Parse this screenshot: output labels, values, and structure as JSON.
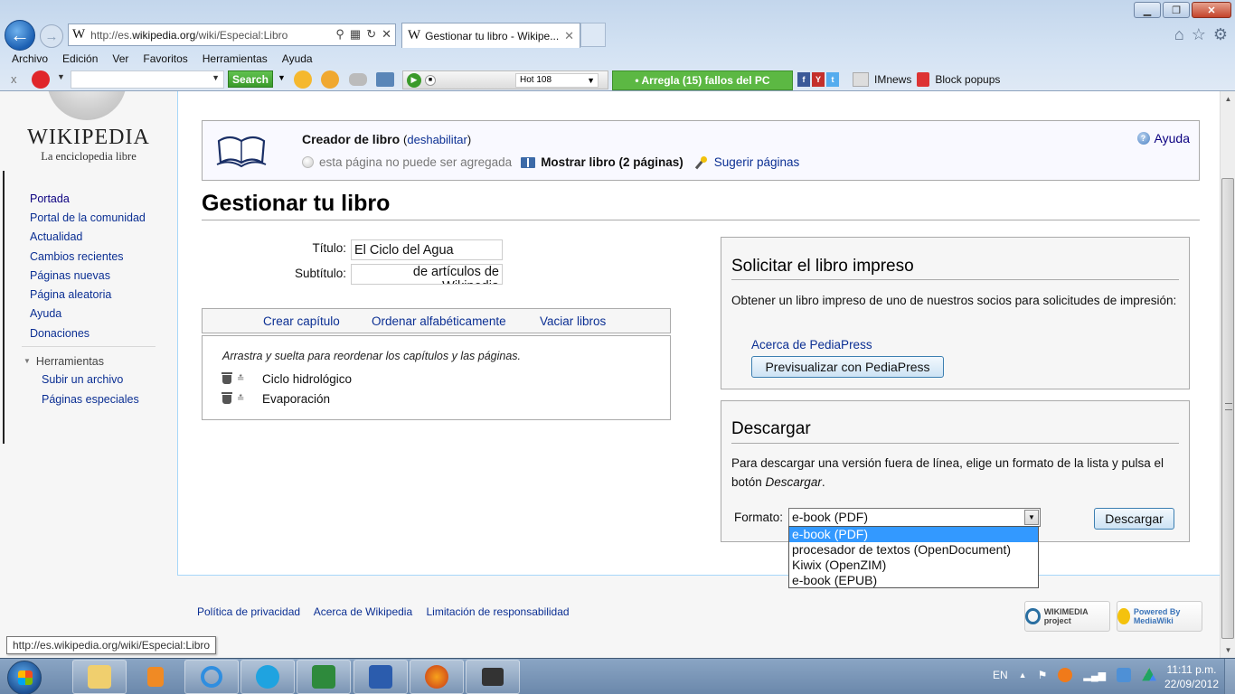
{
  "window": {
    "minimize_icon": "minimize-icon",
    "restore_icon": "restore-icon",
    "close_icon": "close-icon"
  },
  "browser": {
    "address": {
      "prefix": "http://es.",
      "domain": "wikipedia.org",
      "path": "/wiki/Especial:Libro"
    },
    "tab_title": "Gestionar tu libro - Wikipe...",
    "menu": [
      "Archivo",
      "Edición",
      "Ver",
      "Favoritos",
      "Herramientas",
      "Ayuda"
    ],
    "toolbar": {
      "search_button": "Search",
      "search_placeholder": "",
      "radio_station": "Hot 108",
      "fix_button": "• Arregla (15) fallos del PC",
      "imnews": "IMnews",
      "block_popups": "Block popups"
    }
  },
  "wiki": {
    "logo_wordmark": "WIKIPEDIA",
    "logo_tagline": "La enciclopedia libre",
    "sidebar": {
      "nav": [
        {
          "label": "Portada"
        },
        {
          "label": "Portal de la comunidad"
        },
        {
          "label": "Actualidad"
        },
        {
          "label": "Cambios recientes"
        },
        {
          "label": "Páginas nuevas"
        },
        {
          "label": "Página aleatoria"
        },
        {
          "label": "Ayuda"
        },
        {
          "label": "Donaciones"
        }
      ],
      "tools_header": "Herramientas",
      "tools": [
        {
          "label": "Subir un archivo"
        },
        {
          "label": "Páginas especiales"
        }
      ]
    },
    "book_creator": {
      "title": "Creador de libro",
      "disable_link": "deshabilitar",
      "cannot_add": "esta página no puede ser agregada",
      "show_book": "Mostrar libro (2 páginas)",
      "suggest": "Sugerir páginas",
      "help": "Ayuda"
    },
    "page_title": "Gestionar tu libro",
    "form": {
      "title_label": "Título:",
      "title_value": "El Ciclo del Agua",
      "subtitle_label": "Subtítulo:",
      "subtitle_value": "de artículos de Wikipedia"
    },
    "chapter_toolbar": {
      "create_chapter": "Crear capítulo",
      "sort_alpha": "Ordenar alfabéticamente",
      "clear_books": "Vaciar libros"
    },
    "chapter_hint": "Arrastra y suelta para reordenar los capítulos y las páginas.",
    "chapters": [
      {
        "title": "Ciclo hidrológico"
      },
      {
        "title": "Evaporación"
      }
    ],
    "print_panel": {
      "heading": "Solicitar el libro impreso",
      "text": "Obtener un libro impreso de uno de nuestros socios para solicitudes de impresión:",
      "about_link": "Acerca de PediaPress",
      "preview_button": "Previsualizar con PediaPress"
    },
    "download_panel": {
      "heading": "Descargar",
      "text_before": "Para descargar una versión fuera de línea, elige un formato de la lista y pulsa el botón ",
      "text_em": "Descargar",
      "text_after": ".",
      "format_label": "Formato:",
      "selected_format": "e-book (PDF)",
      "format_options": [
        {
          "label": "e-book (PDF)",
          "selected": true
        },
        {
          "label": "procesador de textos (OpenDocument)",
          "selected": false
        },
        {
          "label": "Kiwix (OpenZIM)",
          "selected": false
        },
        {
          "label": "e-book (EPUB)",
          "selected": false
        }
      ],
      "download_button": "Descargar"
    },
    "footer": {
      "links": [
        "Política de privacidad",
        "Acerca de Wikipedia",
        "Limitación de responsabilidad"
      ],
      "badge_wikimedia": "WIKIMEDIA project",
      "badge_mediawiki": "Powered By MediaWiki"
    }
  },
  "status_tooltip": "http://es.wikipedia.org/wiki/Especial:Libro",
  "taskbar": {
    "apps": [
      "file-explorer",
      "media-player",
      "internet-explorer",
      "skype",
      "excel",
      "word",
      "firefox",
      "camera-app"
    ],
    "language": "EN",
    "time": "11:11 p.m.",
    "date": "22/09/2012"
  }
}
